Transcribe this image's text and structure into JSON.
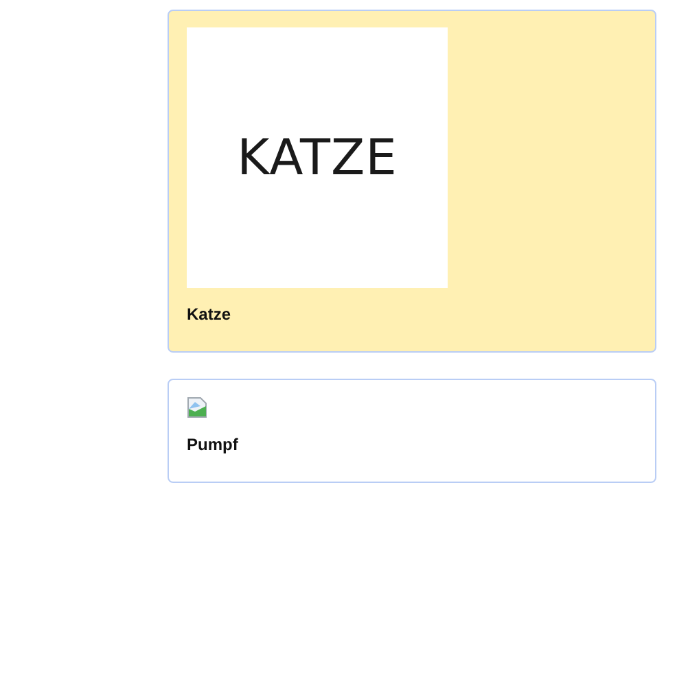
{
  "cards": [
    {
      "title": "Katze",
      "selected": true,
      "image": {
        "kind": "text",
        "text": "KATZE"
      }
    },
    {
      "title": "Pumpf",
      "selected": false,
      "image": {
        "kind": "broken"
      }
    }
  ]
}
